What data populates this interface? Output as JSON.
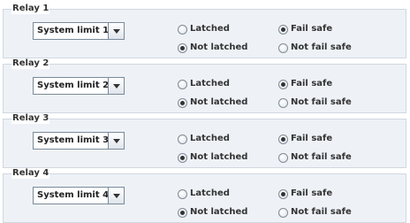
{
  "relays": [
    {
      "title": "Relay 1",
      "limit": "System limit 1",
      "latch_options": [
        {
          "label": "Latched",
          "checked": false
        },
        {
          "label": "Not latched",
          "checked": true
        }
      ],
      "safe_options": [
        {
          "label": "Fail safe",
          "checked": true
        },
        {
          "label": "Not fail safe",
          "checked": false
        }
      ]
    },
    {
      "title": "Relay 2",
      "limit": "System limit 2",
      "latch_options": [
        {
          "label": "Latched",
          "checked": false
        },
        {
          "label": "Not latched",
          "checked": true
        }
      ],
      "safe_options": [
        {
          "label": "Fail safe",
          "checked": true
        },
        {
          "label": "Not fail safe",
          "checked": false
        }
      ]
    },
    {
      "title": "Relay 3",
      "limit": "System limit 3",
      "latch_options": [
        {
          "label": "Latched",
          "checked": false
        },
        {
          "label": "Not latched",
          "checked": true
        }
      ],
      "safe_options": [
        {
          "label": "Fail safe",
          "checked": true
        },
        {
          "label": "Not fail safe",
          "checked": false
        }
      ]
    },
    {
      "title": "Relay 4",
      "limit": "System limit 4",
      "latch_options": [
        {
          "label": "Latched",
          "checked": false
        },
        {
          "label": "Not latched",
          "checked": true
        }
      ],
      "safe_options": [
        {
          "label": "Fail safe",
          "checked": true
        },
        {
          "label": "Not fail safe",
          "checked": false
        }
      ]
    }
  ]
}
